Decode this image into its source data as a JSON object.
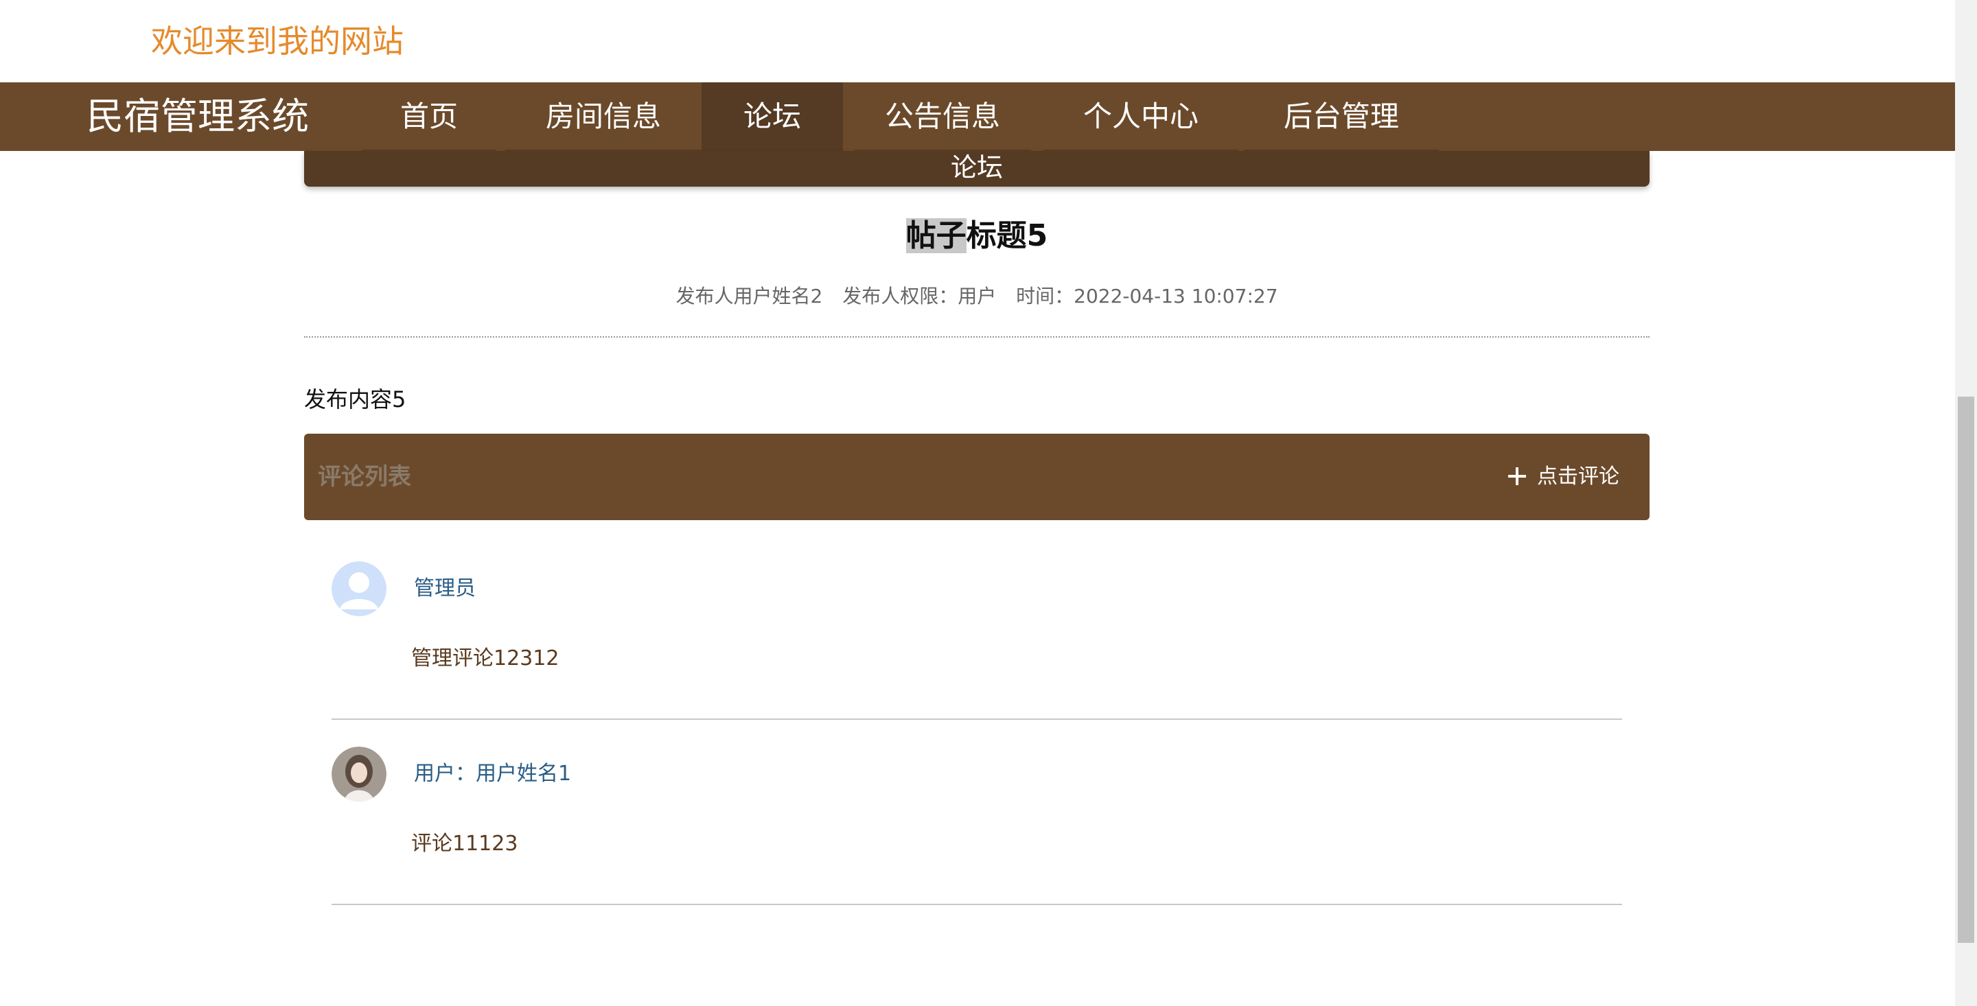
{
  "header": {
    "welcome": "欢迎来到我的网站"
  },
  "navbar": {
    "brand": "民宿管理系统",
    "items": [
      {
        "label": "首页"
      },
      {
        "label": "房间信息"
      },
      {
        "label": "论坛"
      },
      {
        "label": "公告信息"
      },
      {
        "label": "个人中心"
      },
      {
        "label": "后台管理"
      }
    ],
    "active_item": "论坛",
    "bg_color": "#6b4a2b",
    "active_color": "#553a24"
  },
  "banner": {
    "label": "论坛"
  },
  "post": {
    "title_highlight": "帖子",
    "title_rest": "标题5",
    "meta": {
      "author": "发布人用户姓名2",
      "role": "发布人权限：用户",
      "time": "时间：2022-04-13 10:07:27"
    },
    "content": "发布内容5"
  },
  "comments_section": {
    "title": "评论列表",
    "add_button_label": "点击评论",
    "add_button_icon": "plus-icon",
    "items": [
      {
        "author": "管理员",
        "text": "管理评论12312",
        "avatar_icon": "default-user-avatar"
      },
      {
        "author": "用户：用户姓名1",
        "text": "评论11123",
        "avatar_icon": "user-photo-avatar"
      }
    ]
  },
  "colors": {
    "welcome_text": "#e58a2c",
    "commenter_text": "#2a5d86",
    "comment_text": "#5a3a1e"
  }
}
